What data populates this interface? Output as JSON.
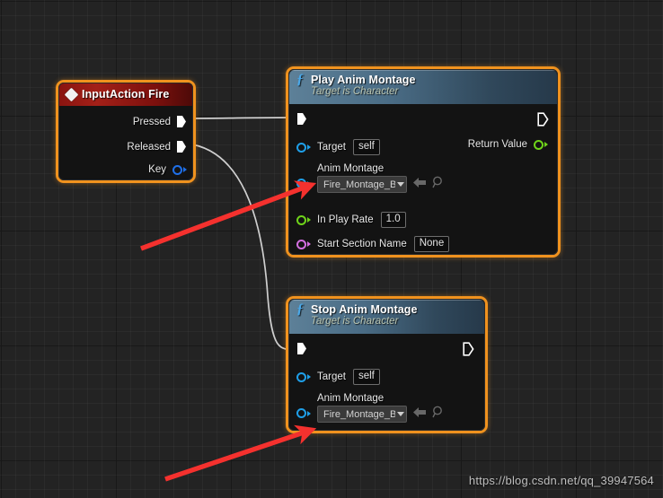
{
  "canvas": {
    "background_color": "#232323",
    "grid_minor_color": "#2e2e2e",
    "grid_major_color": "#151515"
  },
  "watermark": {
    "text": "https://blog.csdn.net/qq_39947564"
  },
  "nodes": {
    "input_action": {
      "title": "InputAction Fire",
      "icon": "diamond-icon",
      "header_color": "#a32018",
      "selection_color": "#f0921e",
      "pins": [
        {
          "label": "Pressed",
          "type": "exec",
          "direction": "output"
        },
        {
          "label": "Released",
          "type": "exec",
          "direction": "output"
        },
        {
          "label": "Key",
          "type": "data",
          "color": "#1f6fe8",
          "direction": "output"
        }
      ]
    },
    "play_anim_montage": {
      "title": "Play Anim Montage",
      "subtitle": "Target is Character",
      "icon": "function-icon",
      "header_color": "#4a6c85",
      "selection_color": "#f0921e",
      "exec_in": "",
      "exec_out": "",
      "pins": [
        {
          "label": "Target",
          "type": "data",
          "color": "#1f9fe8",
          "value": "self",
          "widget": "value-box"
        },
        {
          "label": "Anim Montage",
          "type": "data",
          "color": "#1f9fe8",
          "value": "Fire_Montage_BF",
          "widget": "dropdown"
        },
        {
          "label": "In Play Rate",
          "type": "data",
          "color": "#6fd41a",
          "value": "1.0",
          "widget": "value-box"
        },
        {
          "label": "Start Section Name",
          "type": "data",
          "color": "#d46fe0",
          "value": "None",
          "widget": "value-box"
        }
      ],
      "outputs": [
        {
          "label": "Return Value",
          "type": "data",
          "color": "#6fd41a"
        }
      ]
    },
    "stop_anim_montage": {
      "title": "Stop Anim Montage",
      "subtitle": "Target is Character",
      "icon": "function-icon",
      "header_color": "#4a6c85",
      "selection_color": "#f0921e",
      "pins": [
        {
          "label": "Target",
          "type": "data",
          "color": "#1f9fe8",
          "value": "self",
          "widget": "value-box"
        },
        {
          "label": "Anim Montage",
          "type": "data",
          "color": "#1f9fe8",
          "value": "Fire_Montage_BF",
          "widget": "dropdown"
        }
      ]
    }
  },
  "annotations": {
    "arrow_color": "#f5312e",
    "arrows": [
      {
        "name": "arrow-to-play-anim-montage-dropdown"
      },
      {
        "name": "arrow-to-stop-anim-montage-dropdown"
      }
    ]
  }
}
